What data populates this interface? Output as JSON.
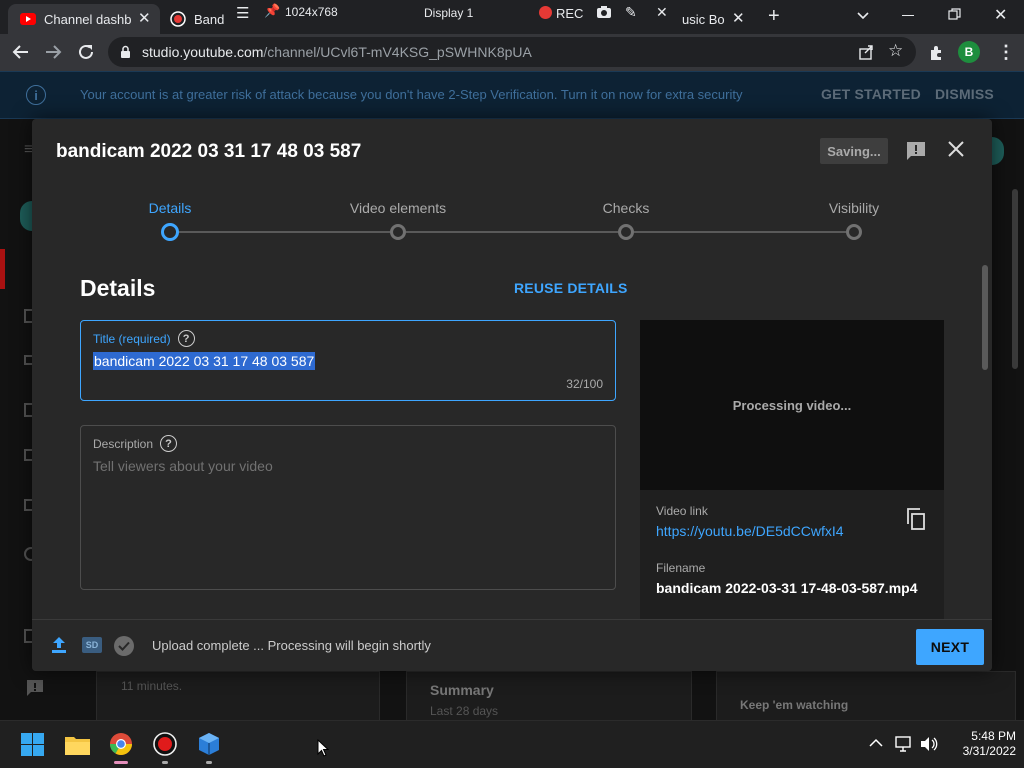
{
  "browser": {
    "tabs": [
      {
        "label": "Channel dashbo",
        "active": true
      },
      {
        "label": "Band"
      },
      {
        "label": "usic Bo"
      }
    ],
    "url_host": "studio.youtube.com",
    "url_path": "/channel/UCvl6T-mV4KSG_pSWHNK8pUA",
    "profile_initial": "B"
  },
  "recorder_bar": {
    "resolution": "1024x768",
    "display": "Display 1",
    "rec_label": "REC"
  },
  "banner": {
    "message": "Your account is at greater risk of attack because you don't have 2-Step Verification. Turn it on now for extra security",
    "get_started": "GET STARTED",
    "dismiss": "DISMISS"
  },
  "background_page": {
    "minutes_text": "11 minutes.",
    "summary_title": "Summary",
    "summary_sub": "Last 28 days",
    "keep_watching": "Keep 'em watching"
  },
  "modal": {
    "title": "bandicam 2022 03 31 17 48 03 587",
    "saving_label": "Saving...",
    "steps": [
      {
        "label": "Details",
        "active": true
      },
      {
        "label": "Video elements"
      },
      {
        "label": "Checks"
      },
      {
        "label": "Visibility"
      }
    ],
    "details_heading": "Details",
    "reuse_details": "REUSE DETAILS",
    "title_field": {
      "label": "Title (required)",
      "value": "bandicam 2022 03 31 17 48 03 587",
      "count": "32/100"
    },
    "description_field": {
      "label": "Description",
      "placeholder": "Tell viewers about your video"
    },
    "preview_text": "Processing video...",
    "video_link_label": "Video link",
    "video_link": "https://youtu.be/DE5dCCwfxI4",
    "filename_label": "Filename",
    "filename": "bandicam 2022-03-31 17-48-03-587.mp4",
    "status": "Upload complete ... Processing will begin shortly",
    "sd_badge": "SD",
    "next_label": "NEXT"
  },
  "taskbar": {
    "time": "5:48 PM",
    "date": "3/31/2022"
  },
  "colors": {
    "accent": "#3ea6ff",
    "modal_bg": "#282828",
    "banner_bg": "#0d2234"
  }
}
